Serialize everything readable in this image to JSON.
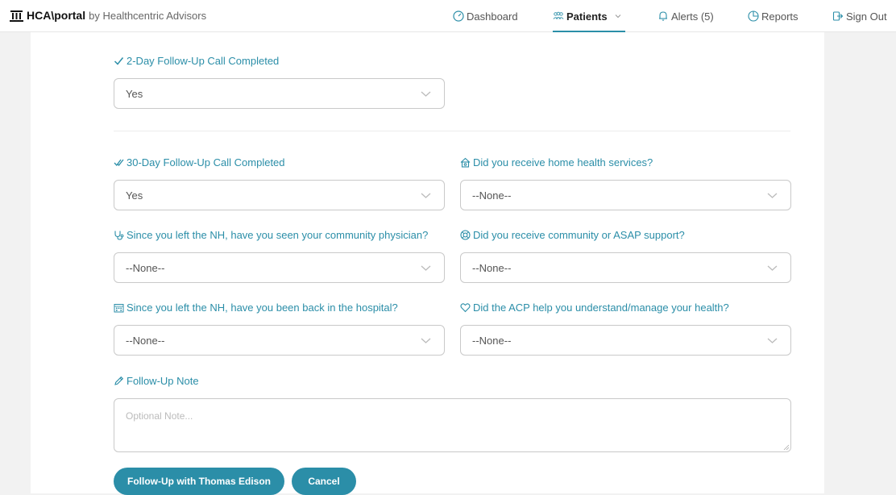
{
  "brand": {
    "name": "HCA\\portal",
    "by": "by Healthcentric Advisors"
  },
  "nav": {
    "dashboard": "Dashboard",
    "patients": "Patients",
    "alerts": "Alerts (5)",
    "reports": "Reports",
    "signout": "Sign Out"
  },
  "form": {
    "two_day": {
      "label": "2-Day Follow-Up Call Completed",
      "value": "Yes"
    },
    "thirty_day": {
      "label": "30-Day Follow-Up Call Completed",
      "value": "Yes"
    },
    "home_health": {
      "label": "Did you receive home health services?",
      "value": "--None--"
    },
    "physician": {
      "label": "Since you left the NH, have you seen your community physician?",
      "value": "--None--"
    },
    "community": {
      "label": "Did you receive community or ASAP support?",
      "value": "--None--"
    },
    "hospital": {
      "label": "Since you left the NH, have you been back in the hospital?",
      "value": "--None--"
    },
    "acp": {
      "label": "Did the ACP help you understand/manage your health?",
      "value": "--None--"
    },
    "note": {
      "label": "Follow-Up Note",
      "placeholder": "Optional Note..."
    }
  },
  "buttons": {
    "submit": "Follow-Up with Thomas Edison",
    "cancel": "Cancel"
  },
  "colors": {
    "accent": "#2b8ea8"
  }
}
